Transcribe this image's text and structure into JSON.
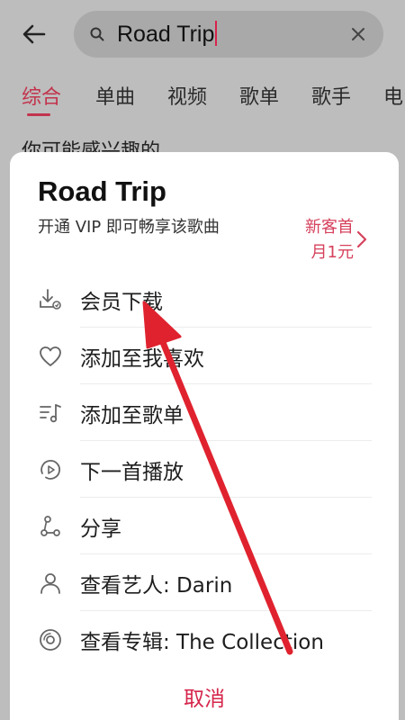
{
  "search": {
    "query": "Road Trip"
  },
  "tabs": [
    {
      "label": "综合",
      "active": true
    },
    {
      "label": "单曲"
    },
    {
      "label": "视频"
    },
    {
      "label": "歌单"
    },
    {
      "label": "歌手"
    },
    {
      "label": "电"
    }
  ],
  "background_heading": "你可能感兴趣的",
  "sheet": {
    "song_title": "Road Trip",
    "vip_text": "开通 VIP 即可畅享该歌曲",
    "vip_promo_line1": "新客首",
    "vip_promo_line2": "月1元",
    "menu": [
      {
        "label": "会员下载",
        "icon": "download-icon"
      },
      {
        "label": "添加至我喜欢",
        "icon": "heart-icon"
      },
      {
        "label": "添加至歌单",
        "icon": "add-to-playlist-icon"
      },
      {
        "label": "下一首播放",
        "icon": "play-next-icon"
      },
      {
        "label": "分享",
        "icon": "share-icon"
      },
      {
        "label": "查看艺人: Darin",
        "icon": "artist-icon"
      },
      {
        "label": "查看专辑: The Collection",
        "icon": "album-icon"
      }
    ],
    "cancel_label": "取消"
  },
  "colors": {
    "accent": "#d6244a",
    "overlay": "#bdbdbd",
    "annotation_arrow": "#e0222f"
  }
}
